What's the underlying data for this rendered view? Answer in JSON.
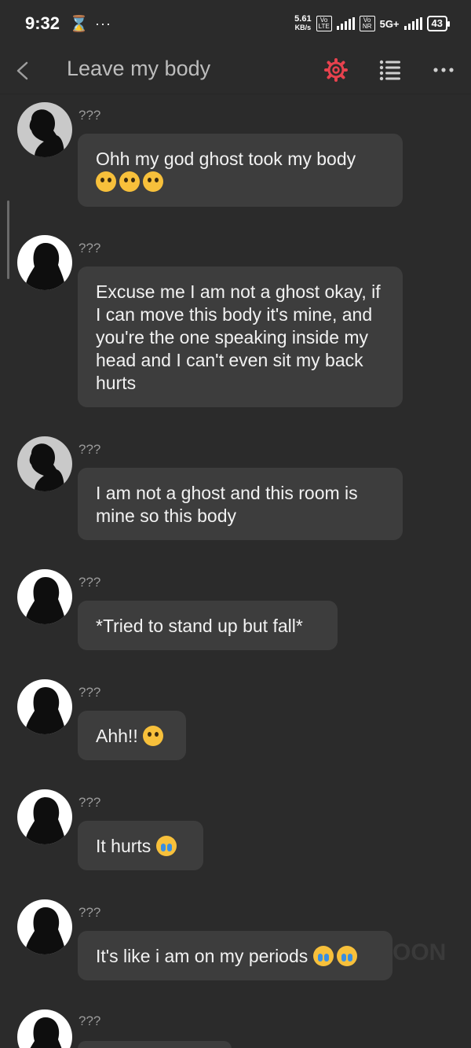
{
  "status_bar": {
    "time": "9:32",
    "hourglass": "⌛",
    "more": "···",
    "speed_value": "5.61",
    "speed_unit": "KB/s",
    "volte_1": "Vo LTE",
    "volte_2": "Vo NR",
    "network": "5G+",
    "battery": "43"
  },
  "header": {
    "title": "Leave my body",
    "back_icon": "chevron-left-icon",
    "settings_icon": "gear-icon",
    "list_icon": "list-icon",
    "more_icon": "more-horizontal-icon",
    "accent_color": "#e8424e"
  },
  "messages": [
    {
      "sender": "???",
      "avatar": "male-silhouette",
      "text": "Ohh my god ghost took my body",
      "emojis": "😵😵😵"
    },
    {
      "sender": "???",
      "avatar": "female-silhouette",
      "text": "Excuse me I am not a ghost okay, if I can move this body it's mine, and you're the one speaking inside my head and I can't even sit my back hurts",
      "emojis": ""
    },
    {
      "sender": "???",
      "avatar": "male-silhouette",
      "text": "I am not a ghost and this room is mine so this body",
      "emojis": ""
    },
    {
      "sender": "???",
      "avatar": "female-silhouette",
      "text": "*Tried to stand up but fall*",
      "emojis": ""
    },
    {
      "sender": "???",
      "avatar": "female-silhouette",
      "text": "Ahh!!",
      "emojis": "😖"
    },
    {
      "sender": "???",
      "avatar": "female-silhouette",
      "text": "It hurts",
      "emojis": "😭"
    },
    {
      "sender": "???",
      "avatar": "female-silhouette",
      "text": "It's like i am on my periods",
      "emojis": "😭😭"
    },
    {
      "sender": "???",
      "avatar": "female-silhouette",
      "text": "",
      "emojis": ""
    }
  ],
  "watermark": "OON"
}
